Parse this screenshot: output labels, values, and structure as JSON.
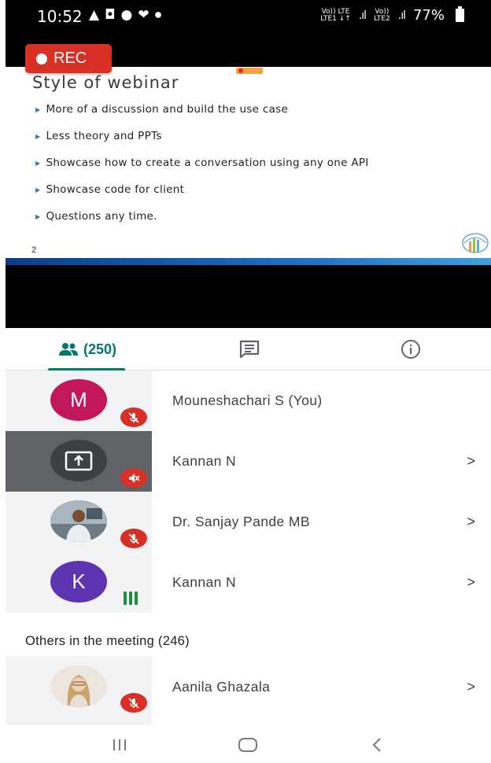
{
  "status_bar": {
    "time": "10:52",
    "notification_icons": [
      "warning-icon",
      "gallery-icon",
      "chat-bubble-icon",
      "heart-icon",
      "dot-icon"
    ],
    "signal_label_1": "Vo)) LTE LTE1 ↓↑",
    "signal_label_2": "Vo)) LTE2",
    "battery": "77%"
  },
  "recording": {
    "label": "REC",
    "color": "#d93025"
  },
  "slide": {
    "title": "Style of webinar",
    "bullets": [
      "More of a discussion and build the use case",
      "Less theory and PPTs",
      "Showcase how to create a conversation using any one API",
      "Showcase code for client",
      "Questions any time."
    ],
    "page_number": "2"
  },
  "tabs": {
    "people_count": "(250)",
    "items": [
      "people-icon",
      "chat-icon",
      "info-icon"
    ],
    "accent_color": "#00796b"
  },
  "participants": [
    {
      "name": "Mouneshachari S (You)",
      "initial": "M",
      "avatar_color": "#c2185b",
      "mic": "muted"
    },
    {
      "name": "Kannan N",
      "presenting": true,
      "mic": "muted"
    },
    {
      "name": "Dr. Sanjay Pande MB",
      "photo": true,
      "mic": "muted"
    },
    {
      "name": "Kannan N",
      "initial": "K",
      "avatar_color": "#5e35b1",
      "mic": "speaking"
    }
  ],
  "others": {
    "label": "Others in the meeting (246)",
    "participants": [
      {
        "name": "Aanila Ghazala",
        "photo": true,
        "mic": "muted"
      }
    ]
  },
  "nav_bar": {
    "items": [
      "recent-apps-icon",
      "home-icon",
      "back-icon"
    ]
  }
}
